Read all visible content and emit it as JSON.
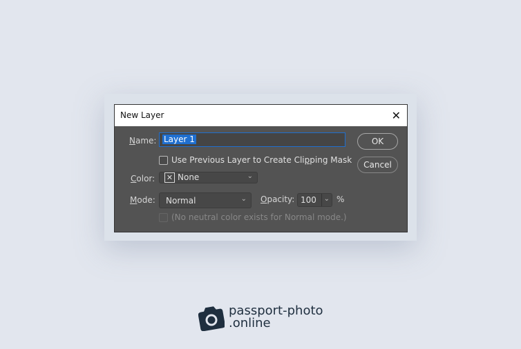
{
  "dialog": {
    "title": "New Layer",
    "close_icon": "close-icon",
    "name_label_u": "N",
    "name_label_rest": "ame:",
    "name_value": "Layer 1",
    "clip_label_a": "Use Previous Layer to Create Cli",
    "clip_label_u": "p",
    "clip_label_b": "ping Mask",
    "color_label_u": "C",
    "color_label_rest": "olor:",
    "color_value": "None",
    "mode_label_u": "M",
    "mode_label_rest": "ode:",
    "mode_value": "Normal",
    "opacity_label_u": "O",
    "opacity_label_rest": "pacity:",
    "opacity_value": "100",
    "opacity_unit": "%",
    "neutral_label": "(No neutral color exists for Normal mode.)",
    "ok": "OK",
    "cancel": "Cancel"
  },
  "logo": {
    "line1": "passport-photo",
    "line2": ".online"
  }
}
